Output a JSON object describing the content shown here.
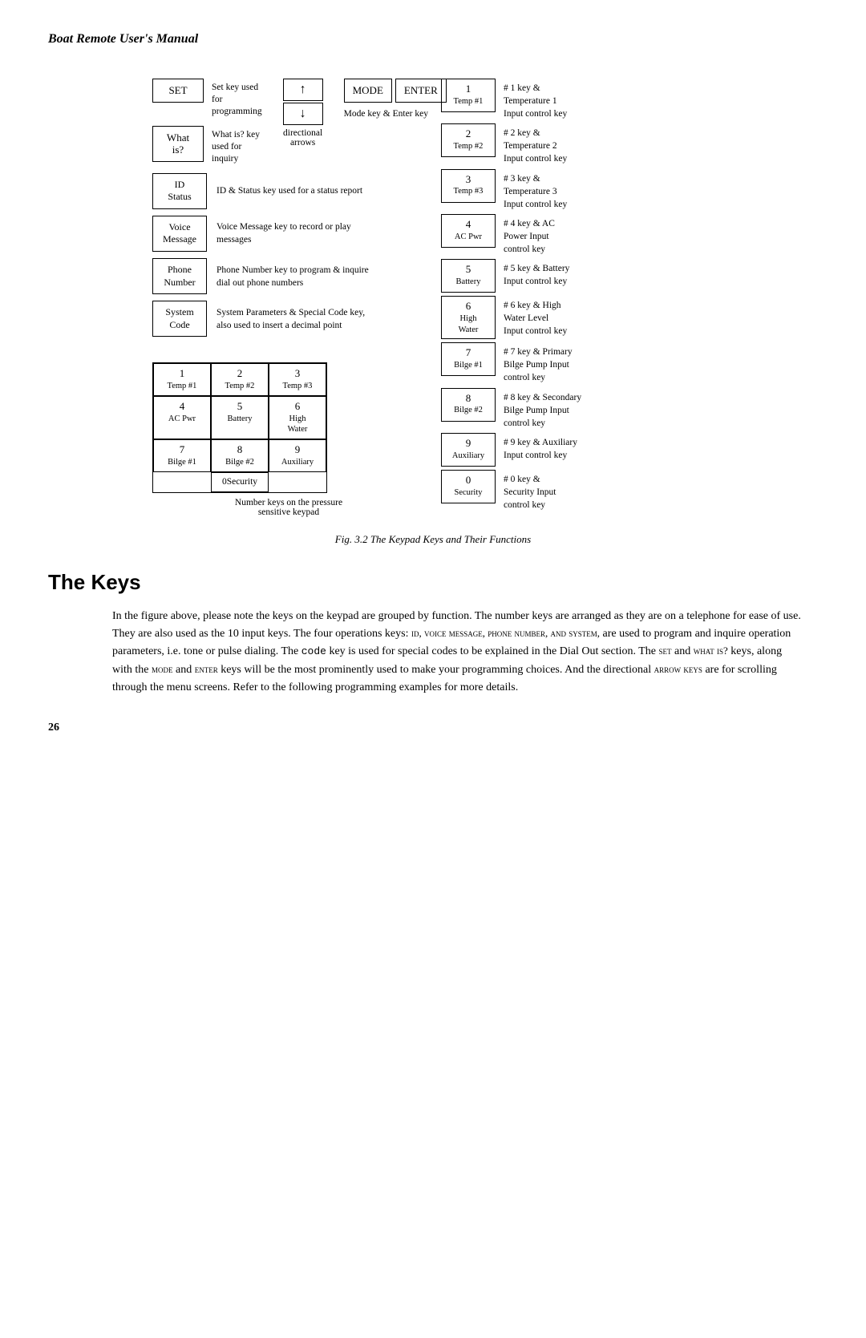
{
  "header": {
    "title": "Boat Remote User's Manual"
  },
  "figure": {
    "caption": "Fig. 3.2 The Keypad Keys and Their Functions"
  },
  "top_keys": {
    "set": {
      "label": "SET",
      "desc": "Set key used for programming"
    },
    "whatis": {
      "label": "What is?",
      "desc": "What is? key used for inquiry"
    },
    "arrows": {
      "up": "↑",
      "down": "↓",
      "label": "directional\narrows"
    },
    "mode": {
      "label": "MODE"
    },
    "enter": {
      "label": "ENTER"
    },
    "mode_enter_desc": "Mode key & Enter key"
  },
  "status_keys": [
    {
      "key": "ID\nStatus",
      "desc": "ID & Status key used for a status report"
    },
    {
      "key": "Voice\nMessage",
      "desc": "Voice Message key to record or play messages"
    },
    {
      "key": "Phone\nNumber",
      "desc": "Phone Number key to program & inquire dial out phone numbers"
    },
    {
      "key": "System\nCode",
      "desc": "System Parameters & Special Code key, also used to insert a decimal point"
    }
  ],
  "keypad": {
    "cells": [
      {
        "num": "1",
        "sub": "Temp #1"
      },
      {
        "num": "2",
        "sub": "Temp #2"
      },
      {
        "num": "3",
        "sub": "Temp #3"
      },
      {
        "num": "4",
        "sub": "AC Pwr"
      },
      {
        "num": "5",
        "sub": "Battery"
      },
      {
        "num": "6",
        "sub": "High\nWater"
      },
      {
        "num": "7",
        "sub": "Bilge #1"
      },
      {
        "num": "8",
        "sub": "Bilge #2"
      },
      {
        "num": "9",
        "sub": "Auxiliary"
      },
      {
        "num": "0",
        "sub": "Security"
      }
    ],
    "note": "Number keys on the pressure\nsensitive keypad"
  },
  "right_keys": [
    {
      "num": "1",
      "sub": "Temp #1",
      "desc": "# 1 key &\nTemperature 1\nInput control key"
    },
    {
      "num": "2",
      "sub": "Temp #2",
      "desc": "# 2 key &\nTemperature 2\nInput control key"
    },
    {
      "num": "3",
      "sub": "Temp #3",
      "desc": "# 3 key &\nTemperature 3\nInput control key"
    },
    {
      "num": "4",
      "sub": "AC Pwr",
      "desc": "# 4 key & AC\nPower Input\ncontrol key"
    },
    {
      "num": "5",
      "sub": "Battery",
      "desc": "# 5 key & Battery\nInput control key"
    },
    {
      "num": "6",
      "sub": "High\nWater",
      "desc": "# 6 key & High\nWater Level\nInput control key"
    },
    {
      "num": "7",
      "sub": "Bilge #1",
      "desc": "# 7 key & Primary\nBilge Pump Input\ncontrol key"
    },
    {
      "num": "8",
      "sub": "Bilge #2",
      "desc": "# 8 key & Secondary\nBilge Pump Input\ncontrol key"
    },
    {
      "num": "9",
      "sub": "Auxiliary",
      "desc": "# 9 key & Auxiliary\nInput control key"
    },
    {
      "num": "0",
      "sub": "Security",
      "desc": "# 0 key &\nSecurity Input\ncontrol key"
    }
  ],
  "section": {
    "heading": "The Keys",
    "body": "In the figure above, please note the keys on the keypad are grouped by function. The number keys are arranged as they are on a telephone for ease of use. They are also used as the 10 input keys. The four operations keys: ID, VOICE MESSAGE, PHONE NUMBER, AND SYSTEM, are used to program and inquire operation parameters, i.e. tone or pulse dialing. The CODE key is used for special codes to be explained in the Dial Out section. The SET and WHAT IS? keys, along with the MODE and ENTER keys will be the most prominently used to make your programming choices. And the directional ARROW KEYS are for scrolling through the menu screens. Refer to the following programming examples for more details."
  },
  "page_number": "26"
}
